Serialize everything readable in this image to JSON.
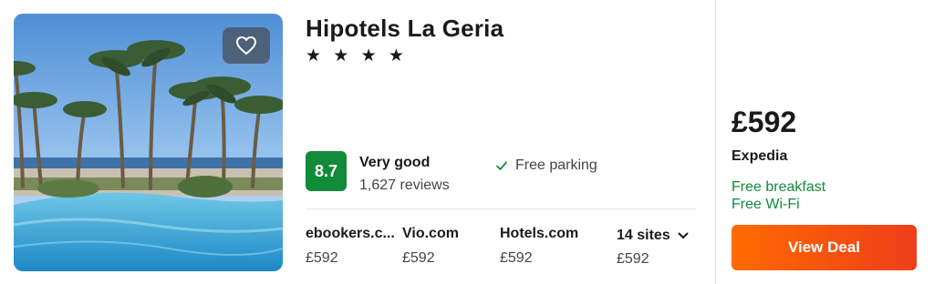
{
  "hotel": {
    "name": "Hipotels La Geria",
    "stars_text": "★ ★ ★ ★",
    "star_count": 4
  },
  "rating": {
    "score": "8.7",
    "label": "Very good",
    "reviews": "1,627 reviews",
    "badge_color": "#118a3a"
  },
  "amenities": [
    "Free parking"
  ],
  "sites": [
    {
      "name": "ebookers.c...",
      "price": "£592"
    },
    {
      "name": "Vio.com",
      "price": "£592"
    },
    {
      "name": "Hotels.com",
      "price": "£592"
    }
  ],
  "more_sites": {
    "label": "14 sites",
    "price": "£592"
  },
  "deal": {
    "price": "£592",
    "provider": "Expedia",
    "perks": [
      "Free breakfast",
      "Free Wi-Fi"
    ],
    "button_label": "View Deal",
    "button_color": "#ff6a00"
  },
  "icons": {
    "favorite": "heart-icon",
    "check": "check-icon",
    "expand": "chevron-down-icon"
  }
}
